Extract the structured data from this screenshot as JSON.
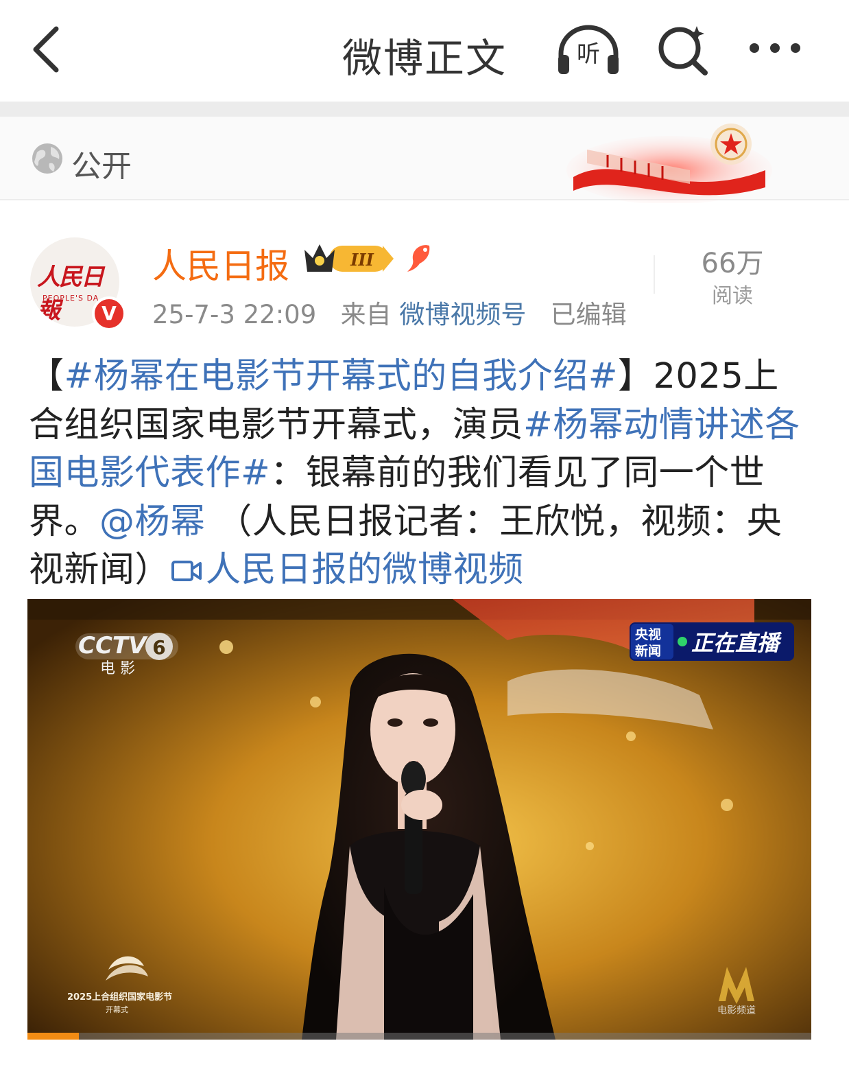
{
  "header": {
    "title": "微博正文",
    "icons": [
      "back-icon",
      "listen-icon",
      "search-icon",
      "more-icon"
    ],
    "listen_glyph": "听"
  },
  "visibility": {
    "label": "公开",
    "icon": "globe-icon"
  },
  "author": {
    "name": "人民日报",
    "avatar_text": "人民日報",
    "avatar_sub": "PEOPLE'S DA",
    "verified_mark": "V",
    "vip_level": "III",
    "timestamp": "25-7-3 22:09",
    "source_prefix": "来自",
    "source": "微博视频号",
    "edited": "已编辑"
  },
  "stats": {
    "reads_value": "66万",
    "reads_label": "阅读"
  },
  "post": {
    "open_bracket": "【",
    "hashtag_1": "#杨幂在电影节开幕式的自我介绍#",
    "text_1": "】2025上合组织国家电影节开幕式，演员",
    "hashtag_2": "#杨幂动情讲述各国电影代表作#",
    "text_2": "：银幕前的我们看见了同一个世界。",
    "mention": "@杨幂",
    "text_3": " （人民日报记者：王欣悦，视频：央视新闻）",
    "video_link": "人民日报的微博视频"
  },
  "video": {
    "channel_logo": "CCTV",
    "channel_number": "6",
    "channel_name": "电 影",
    "live_badge_source": "央视新闻",
    "live_badge_text": "正在直播",
    "event_caption": "2025上合组织国家电影节",
    "event_sub": "开幕式",
    "watermark_label": "电影频道",
    "progress": 0.066
  },
  "colors": {
    "username": "#f46c12",
    "link": "#3f72b8",
    "verified": "#e5312a"
  }
}
